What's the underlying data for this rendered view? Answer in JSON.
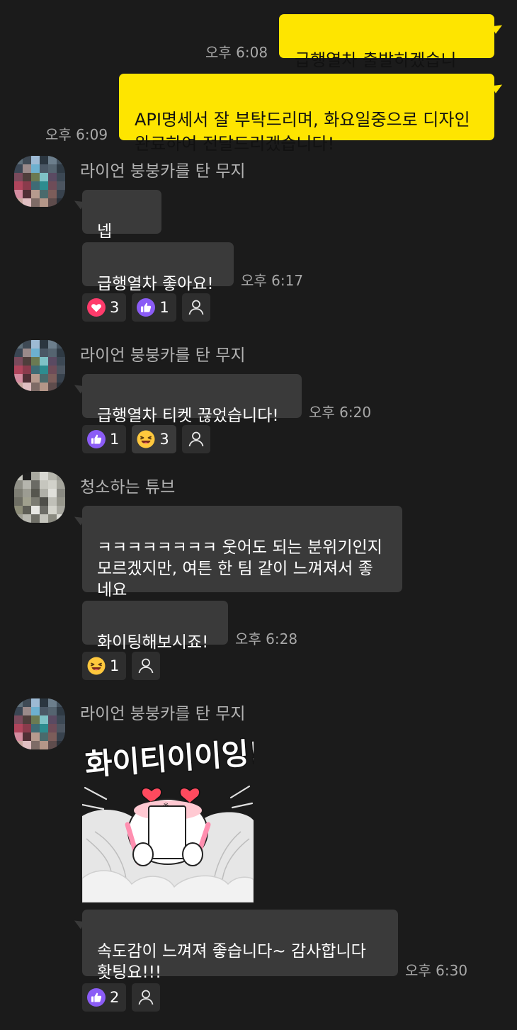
{
  "colors": {
    "background": "#1b1b1b",
    "out_bubble": "#fee500",
    "in_bubble": "#3a3a3a",
    "heart_reaction": "#ff3b6b",
    "like_reaction": "#8b5cf6"
  },
  "outgoing": [
    {
      "text": "급행열차 출발하겠습니다!",
      "time": "오후 6:08"
    },
    {
      "text": "API명세서 잘 부탁드리며, 화요일중으로 디자인\n완료하여 전달드리겠습니다!",
      "time": "오후 6:09"
    }
  ],
  "groups": [
    {
      "sender": "라이언 붕붕카를 탄 무지",
      "messages": [
        {
          "text": "넵~~~"
        },
        {
          "text": "급행열차 좋아요!",
          "time": "오후 6:17"
        }
      ],
      "reactions": [
        {
          "icon": "heart-icon",
          "count": "3"
        },
        {
          "icon": "thumbs-up-icon",
          "count": "1"
        }
      ]
    },
    {
      "sender": "라이언 붕붕카를 탄 무지",
      "messages": [
        {
          "text": "급행열차 티켓 끊었습니다!",
          "time": "오후 6:20"
        }
      ],
      "reactions": [
        {
          "icon": "thumbs-up-icon",
          "count": "1"
        },
        {
          "icon": "laughing-face-icon",
          "count": "3"
        }
      ]
    },
    {
      "sender": "청소하는 튜브",
      "messages": [
        {
          "text": "ㅋㅋㅋㅋㅋㅋㅋㅋ 웃어도 되는 분위기인지\n모르겠지만, 여튼 한 팀 같이 느껴져서 좋\n네요"
        },
        {
          "text": "화이팅해보시죠!",
          "time": "오후 6:28"
        }
      ],
      "reactions": [
        {
          "icon": "laughing-face-icon",
          "count": "1"
        }
      ]
    },
    {
      "sender": "라이언 붕붕카를 탄 무지",
      "sticker": {
        "lettering": "화이티이이잉!"
      },
      "messages": [
        {
          "text": "속도감이 느껴져 좋습니다~ 감사합니다\n홧팅요!!!",
          "time": "오후 6:30"
        }
      ],
      "reactions": [
        {
          "icon": "thumbs-up-icon",
          "count": "2"
        }
      ]
    }
  ]
}
